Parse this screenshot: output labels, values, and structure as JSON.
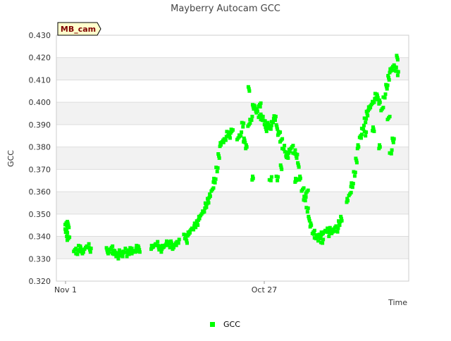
{
  "chart_data": {
    "type": "scatter",
    "title": "Mayberry Autocam GCC",
    "xlabel": "Time",
    "ylabel": "GCC",
    "ylim": [
      0.32,
      0.43
    ],
    "yticks": [
      "0.320",
      "0.330",
      "0.340",
      "0.350",
      "0.360",
      "0.370",
      "0.380",
      "0.390",
      "0.400",
      "0.410",
      "0.420",
      "0.430"
    ],
    "x_tick_labels": [
      "Nov 1",
      "Oct 27"
    ],
    "grid": true,
    "legend_position": "bottom",
    "badge": "MB_cam",
    "series": [
      {
        "name": "GCC",
        "color": "#00ff00",
        "points": [
          [
            0,
            0.346
          ],
          [
            0,
            0.344
          ],
          [
            0,
            0.341
          ],
          [
            1,
            0.345
          ],
          [
            1,
            0.339
          ],
          [
            4,
            0.334
          ],
          [
            5,
            0.333
          ],
          [
            6,
            0.335
          ],
          [
            7,
            0.334
          ],
          [
            8,
            0.333
          ],
          [
            9,
            0.335
          ],
          [
            10,
            0.336
          ],
          [
            11,
            0.334
          ],
          [
            19,
            0.334
          ],
          [
            20,
            0.333
          ],
          [
            21,
            0.335
          ],
          [
            22,
            0.333
          ],
          [
            23,
            0.332
          ],
          [
            24,
            0.331
          ],
          [
            25,
            0.333
          ],
          [
            26,
            0.332
          ],
          [
            27,
            0.334
          ],
          [
            28,
            0.332
          ],
          [
            29,
            0.333
          ],
          [
            30,
            0.334
          ],
          [
            31,
            0.333
          ],
          [
            32,
            0.334
          ],
          [
            33,
            0.335
          ],
          [
            34,
            0.334
          ],
          [
            40,
            0.335
          ],
          [
            41,
            0.336
          ],
          [
            42,
            0.337
          ],
          [
            43,
            0.335
          ],
          [
            44,
            0.334
          ],
          [
            45,
            0.335
          ],
          [
            46,
            0.336
          ],
          [
            47,
            0.337
          ],
          [
            48,
            0.336
          ],
          [
            49,
            0.337
          ],
          [
            50,
            0.335
          ],
          [
            51,
            0.337
          ],
          [
            52,
            0.338
          ],
          [
            55,
            0.34
          ],
          [
            56,
            0.338
          ],
          [
            57,
            0.341
          ],
          [
            58,
            0.343
          ],
          [
            59,
            0.344
          ],
          [
            60,
            0.345
          ],
          [
            61,
            0.346
          ],
          [
            62,
            0.348
          ],
          [
            63,
            0.35
          ],
          [
            64,
            0.352
          ],
          [
            65,
            0.354
          ],
          [
            66,
            0.356
          ],
          [
            67,
            0.358
          ],
          [
            68,
            0.361
          ],
          [
            69,
            0.365
          ],
          [
            70,
            0.37
          ],
          [
            71,
            0.376
          ],
          [
            72,
            0.381
          ],
          [
            73,
            0.383
          ],
          [
            74,
            0.384
          ],
          [
            75,
            0.386
          ],
          [
            76,
            0.385
          ],
          [
            77,
            0.387
          ],
          [
            80,
            0.384
          ],
          [
            81,
            0.386
          ],
          [
            82,
            0.39
          ],
          [
            83,
            0.383
          ],
          [
            84,
            0.38
          ],
          [
            85,
            0.39
          ],
          [
            86,
            0.393
          ],
          [
            87,
            0.398
          ],
          [
            88,
            0.397
          ],
          [
            89,
            0.396
          ],
          [
            90,
            0.394
          ],
          [
            91,
            0.393
          ],
          [
            92,
            0.391
          ],
          [
            93,
            0.388
          ],
          [
            94,
            0.39
          ],
          [
            95,
            0.389
          ],
          [
            96,
            0.392
          ],
          [
            97,
            0.393
          ],
          [
            98,
            0.389
          ],
          [
            99,
            0.386
          ],
          [
            100,
            0.383
          ],
          [
            101,
            0.38
          ],
          [
            102,
            0.377
          ],
          [
            103,
            0.376
          ],
          [
            104,
            0.378
          ],
          [
            105,
            0.38
          ],
          [
            106,
            0.378
          ],
          [
            107,
            0.376
          ],
          [
            108,
            0.372
          ],
          [
            109,
            0.366
          ],
          [
            110,
            0.361
          ],
          [
            111,
            0.357
          ],
          [
            112,
            0.352
          ],
          [
            113,
            0.348
          ],
          [
            114,
            0.345
          ],
          [
            115,
            0.342
          ],
          [
            116,
            0.34
          ],
          [
            117,
            0.339
          ],
          [
            118,
            0.34
          ],
          [
            119,
            0.341
          ],
          [
            120,
            0.342
          ],
          [
            121,
            0.343
          ],
          [
            122,
            0.341
          ],
          [
            123,
            0.343
          ],
          [
            124,
            0.342
          ],
          [
            125,
            0.344
          ],
          [
            126,
            0.343
          ],
          [
            127,
            0.346
          ],
          [
            128,
            0.348
          ],
          [
            131,
            0.356
          ],
          [
            132,
            0.359
          ],
          [
            133,
            0.363
          ],
          [
            134,
            0.368
          ],
          [
            135,
            0.374
          ],
          [
            136,
            0.38
          ],
          [
            137,
            0.385
          ],
          [
            138,
            0.389
          ],
          [
            139,
            0.392
          ],
          [
            140,
            0.395
          ],
          [
            141,
            0.397
          ],
          [
            142,
            0.399
          ],
          [
            143,
            0.401
          ],
          [
            144,
            0.403
          ],
          [
            145,
            0.402
          ],
          [
            146,
            0.4
          ],
          [
            147,
            0.397
          ],
          [
            148,
            0.403
          ],
          [
            149,
            0.407
          ],
          [
            150,
            0.411
          ],
          [
            151,
            0.414
          ],
          [
            152,
            0.416
          ],
          [
            153,
            0.415
          ],
          [
            154,
            0.413
          ],
          [
            85,
            0.406
          ],
          [
            87,
            0.366
          ],
          [
            90,
            0.399
          ],
          [
            95,
            0.366
          ],
          [
            98,
            0.366
          ],
          [
            100,
            0.371
          ],
          [
            107,
            0.365
          ],
          [
            112,
            0.36
          ],
          [
            119,
            0.338
          ],
          [
            139,
            0.386
          ],
          [
            143,
            0.388
          ],
          [
            146,
            0.38
          ],
          [
            150,
            0.393
          ],
          [
            151,
            0.378
          ],
          [
            152,
            0.383
          ],
          [
            154,
            0.42
          ]
        ]
      }
    ]
  }
}
